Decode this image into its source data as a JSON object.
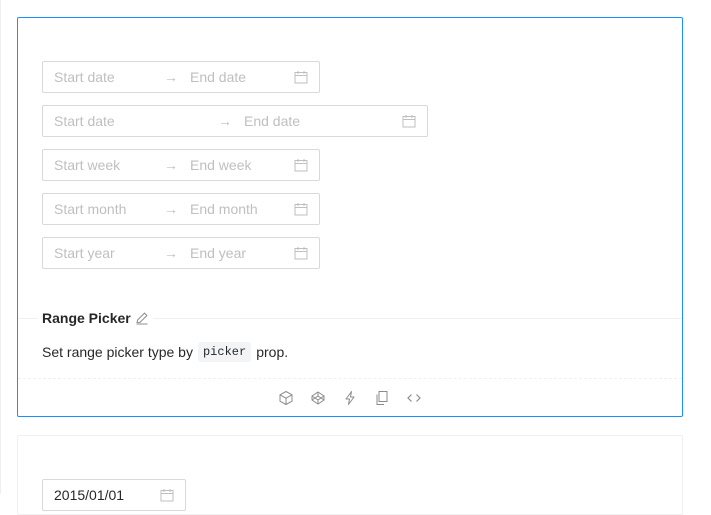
{
  "pickers": [
    {
      "start_placeholder": "Start date",
      "end_placeholder": "End date"
    },
    {
      "start_placeholder": "Start date",
      "end_placeholder": "End date"
    },
    {
      "start_placeholder": "Start week",
      "end_placeholder": "End week"
    },
    {
      "start_placeholder": "Start month",
      "end_placeholder": "End month"
    },
    {
      "start_placeholder": "Start year",
      "end_placeholder": "End year"
    }
  ],
  "separator": "→",
  "demo": {
    "title": "Range Picker",
    "desc_before": "Set range picker type by",
    "desc_code": "picker",
    "desc_after": "prop."
  },
  "next_demo": {
    "date_value": "2015/01/01"
  },
  "icons": {
    "calendar": "calendar-icon",
    "edit": "edit-icon",
    "codesandbox": "codesandbox-icon",
    "codepen": "codepen-icon",
    "stackblitz": "thunderbolt-icon",
    "copy": "copy-icon",
    "code": "code-icon"
  },
  "colors": {
    "accent": "#1890ff",
    "border": "#d9d9d9",
    "placeholder": "#bfbfbf"
  }
}
